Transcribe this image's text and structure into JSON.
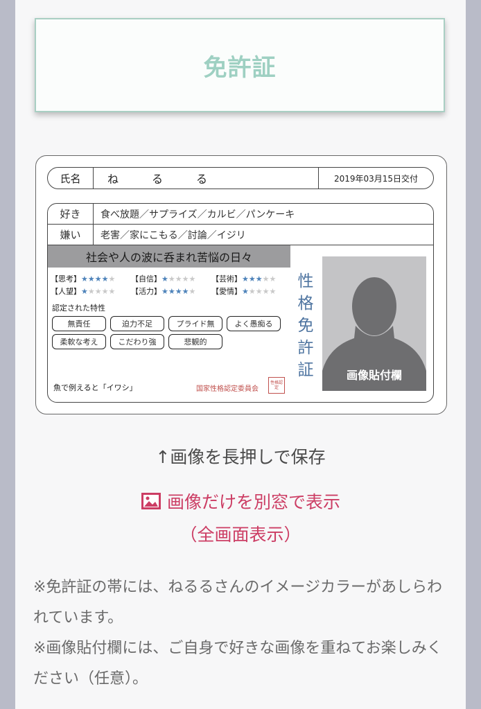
{
  "header": {
    "title": "免許証"
  },
  "card": {
    "name_label": "氏名",
    "name_value": "ねるる",
    "issue_date": "2019年03月15日交付",
    "like_label": "好き",
    "like_value": "食べ放題／サプライズ／カルビ／パンケーキ",
    "dislike_label": "嫌い",
    "dislike_value": "老害／家にこもる／討論／イジリ",
    "band_text": "社会や人の波に呑まれ苦悩の日々",
    "params": [
      {
        "label": "【思考】",
        "on": "★★★★",
        "off": "★",
        "rating": 4
      },
      {
        "label": "【自信】",
        "on": "★",
        "off": "★★★★",
        "rating": 1
      },
      {
        "label": "【芸術】",
        "on": "★★★",
        "off": "★★",
        "rating": 3
      },
      {
        "label": "【人望】",
        "on": "★",
        "off": "★★★★",
        "rating": 1
      },
      {
        "label": "【活力】",
        "on": "★★★★",
        "off": "★",
        "rating": 4
      },
      {
        "label": "【愛情】",
        "on": "★",
        "off": "★★★★",
        "rating": 1
      }
    ],
    "trait_heading": "認定された特性",
    "traits": [
      "無責任",
      "迫力不足",
      "プライド無",
      "よく愚痴る",
      "柔軟な考え",
      "こだわり強",
      "悲観的"
    ],
    "fish_text": "魚で例えると「イワシ」",
    "committee": "国家性格認定委員会",
    "seal_text": "性格認定",
    "vertical_title": "性格免許証",
    "photo_label": "画像貼付欄",
    "band_color": "#9c9c9e",
    "star_color": "#4e83ba"
  },
  "save_hint": "↑画像を長押しで保存",
  "open_link": "画像だけを別窓で表示",
  "open_icon": "image-icon",
  "fullscreen": "（全画面表示）",
  "notes": [
    "※免許証の帯には、ねるるさんのイメージカラーがあしらわれています。",
    "※画像貼付欄には、ご自身で好きな画像を重ねてお楽しみください（任意）。"
  ],
  "accent_color": "#cc3d64"
}
